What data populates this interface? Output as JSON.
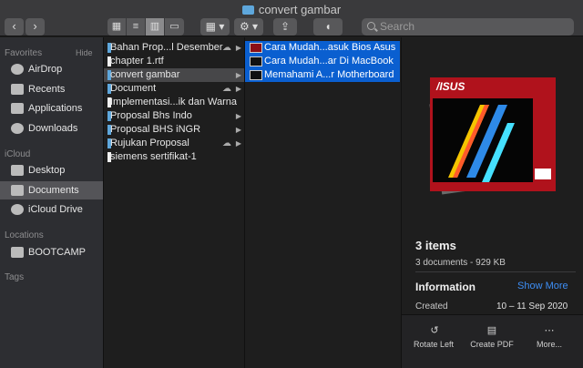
{
  "window": {
    "title": "convert gambar"
  },
  "toolbar": {
    "back_icon": "chevron-left-icon",
    "forward_icon": "chevron-right-icon",
    "view_modes": [
      "icon-view-icon",
      "list-view-icon",
      "column-view-icon",
      "gallery-view-icon"
    ],
    "active_view": "column",
    "group_icon": "grid-icon",
    "action_icon": "gear-icon",
    "share_icon": "share-icon",
    "tag_icon": "tag-icon",
    "search_placeholder": "Search"
  },
  "sidebar": {
    "favorites_label": "Favorites",
    "hide_label": "Hide",
    "favorites": [
      {
        "label": "AirDrop",
        "icon": "airdrop-icon"
      },
      {
        "label": "Recents",
        "icon": "clock-icon"
      },
      {
        "label": "Applications",
        "icon": "applications-icon"
      },
      {
        "label": "Downloads",
        "icon": "download-icon"
      }
    ],
    "icloud_label": "iCloud",
    "icloud": [
      {
        "label": "Desktop",
        "icon": "desktop-icon"
      },
      {
        "label": "Documents",
        "icon": "document-icon",
        "selected": true
      },
      {
        "label": "iCloud Drive",
        "icon": "cloud-icon"
      }
    ],
    "locations_label": "Locations",
    "locations": [
      {
        "label": "BOOTCAMP",
        "icon": "disk-icon"
      }
    ],
    "tags_label": "Tags"
  },
  "column1": {
    "items": [
      {
        "label": "Bahan Prop...l Desember",
        "type": "folder",
        "cloud": true,
        "arrow": true
      },
      {
        "label": "chapter 1.rtf",
        "type": "file",
        "cloud": false,
        "arrow": false
      },
      {
        "label": "convert gambar",
        "type": "folder",
        "cloud": false,
        "arrow": true,
        "highlighted": true
      },
      {
        "label": "Document",
        "type": "folder",
        "cloud": true,
        "arrow": true
      },
      {
        "label": "Implementasi...ik dan Warna",
        "type": "file",
        "cloud": false,
        "arrow": false
      },
      {
        "label": "Proposal Bhs Indo",
        "type": "folder",
        "cloud": false,
        "arrow": true
      },
      {
        "label": "Proposal BHS iNGR",
        "type": "folder",
        "cloud": false,
        "arrow": true
      },
      {
        "label": "Rujukan Proposal",
        "type": "folder",
        "cloud": true,
        "arrow": true
      },
      {
        "label": "siemens sertifikat-1",
        "type": "file",
        "cloud": false,
        "arrow": false
      }
    ]
  },
  "column2": {
    "items": [
      {
        "label": "Cara Mudah...asuk Bios Asus",
        "thumb": "red"
      },
      {
        "label": "Cara Mudah...ar Di MacBook",
        "thumb": "dark"
      },
      {
        "label": "Memahami A...r Motherboard",
        "thumb": "dark"
      }
    ]
  },
  "preview": {
    "count": "3 items",
    "summary": "3 documents - 929 KB",
    "info_label": "Information",
    "show_more": "Show More",
    "created_label": "Created",
    "created_value": "10 – 11 Sep 2020",
    "actions": [
      {
        "label": "Rotate Left",
        "icon": "rotate-left-icon"
      },
      {
        "label": "Create PDF",
        "icon": "pdf-icon"
      },
      {
        "label": "More...",
        "icon": "ellipsis-icon"
      }
    ]
  },
  "colors": {
    "accent": "#0a5fd0",
    "folder": "#5ea7dc",
    "link": "#3d8ef5"
  }
}
